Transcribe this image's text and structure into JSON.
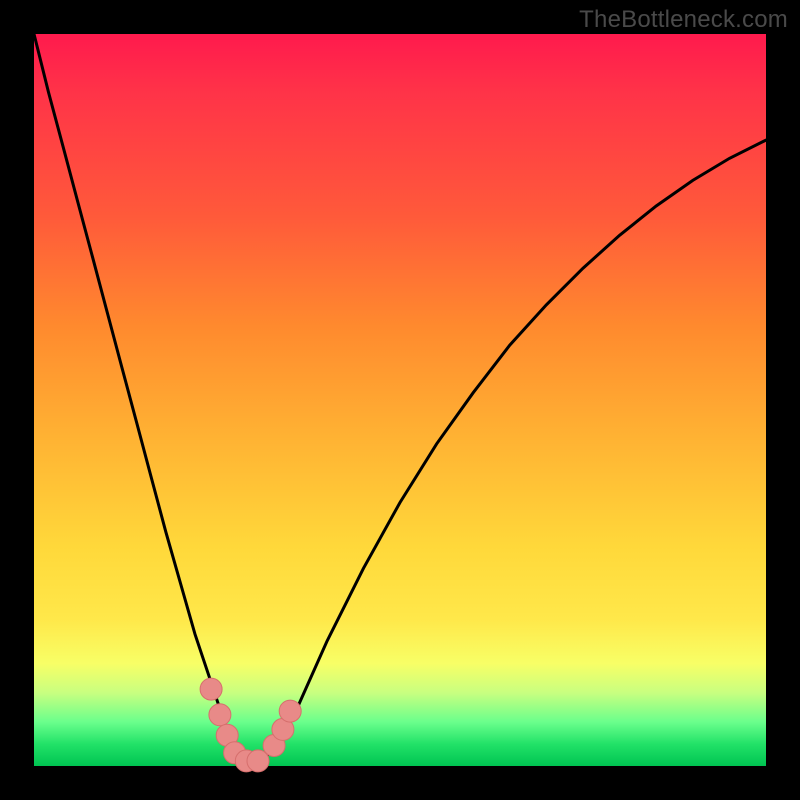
{
  "watermark": "TheBottleneck.com",
  "colors": {
    "frame": "#000000",
    "curve": "#000000",
    "marker_fill": "#e88a88",
    "marker_stroke": "#d66f6d"
  },
  "chart_data": {
    "type": "line",
    "title": "",
    "xlabel": "",
    "ylabel": "",
    "xlim": [
      0,
      100
    ],
    "ylim": [
      0,
      100
    ],
    "series": [
      {
        "name": "bottleneck-curve",
        "x": [
          0,
          2,
          4,
          6,
          8,
          10,
          12,
          14,
          16,
          18,
          20,
          22,
          24,
          26,
          27,
          27.5,
          28,
          29,
          30,
          31,
          32,
          34,
          36,
          40,
          45,
          50,
          55,
          60,
          65,
          70,
          75,
          80,
          85,
          90,
          95,
          100
        ],
        "y": [
          100,
          92,
          84.5,
          77,
          69.5,
          62,
          54.5,
          47,
          39.5,
          32,
          25,
          18,
          12,
          6,
          3,
          2,
          1.2,
          0.6,
          0.5,
          0.8,
          1.6,
          4,
          8,
          17,
          27,
          36,
          44,
          51,
          57.5,
          63,
          68,
          72.5,
          76.5,
          80,
          83,
          85.5
        ]
      }
    ],
    "markers": [
      {
        "x": 24.2,
        "y": 10.5
      },
      {
        "x": 25.4,
        "y": 7.0
      },
      {
        "x": 26.4,
        "y": 4.2
      },
      {
        "x": 27.4,
        "y": 1.8
      },
      {
        "x": 29.0,
        "y": 0.7
      },
      {
        "x": 30.6,
        "y": 0.7
      },
      {
        "x": 32.8,
        "y": 2.8
      },
      {
        "x": 34.0,
        "y": 5.0
      },
      {
        "x": 35.0,
        "y": 7.5
      }
    ],
    "marker_radius_px": 11
  }
}
